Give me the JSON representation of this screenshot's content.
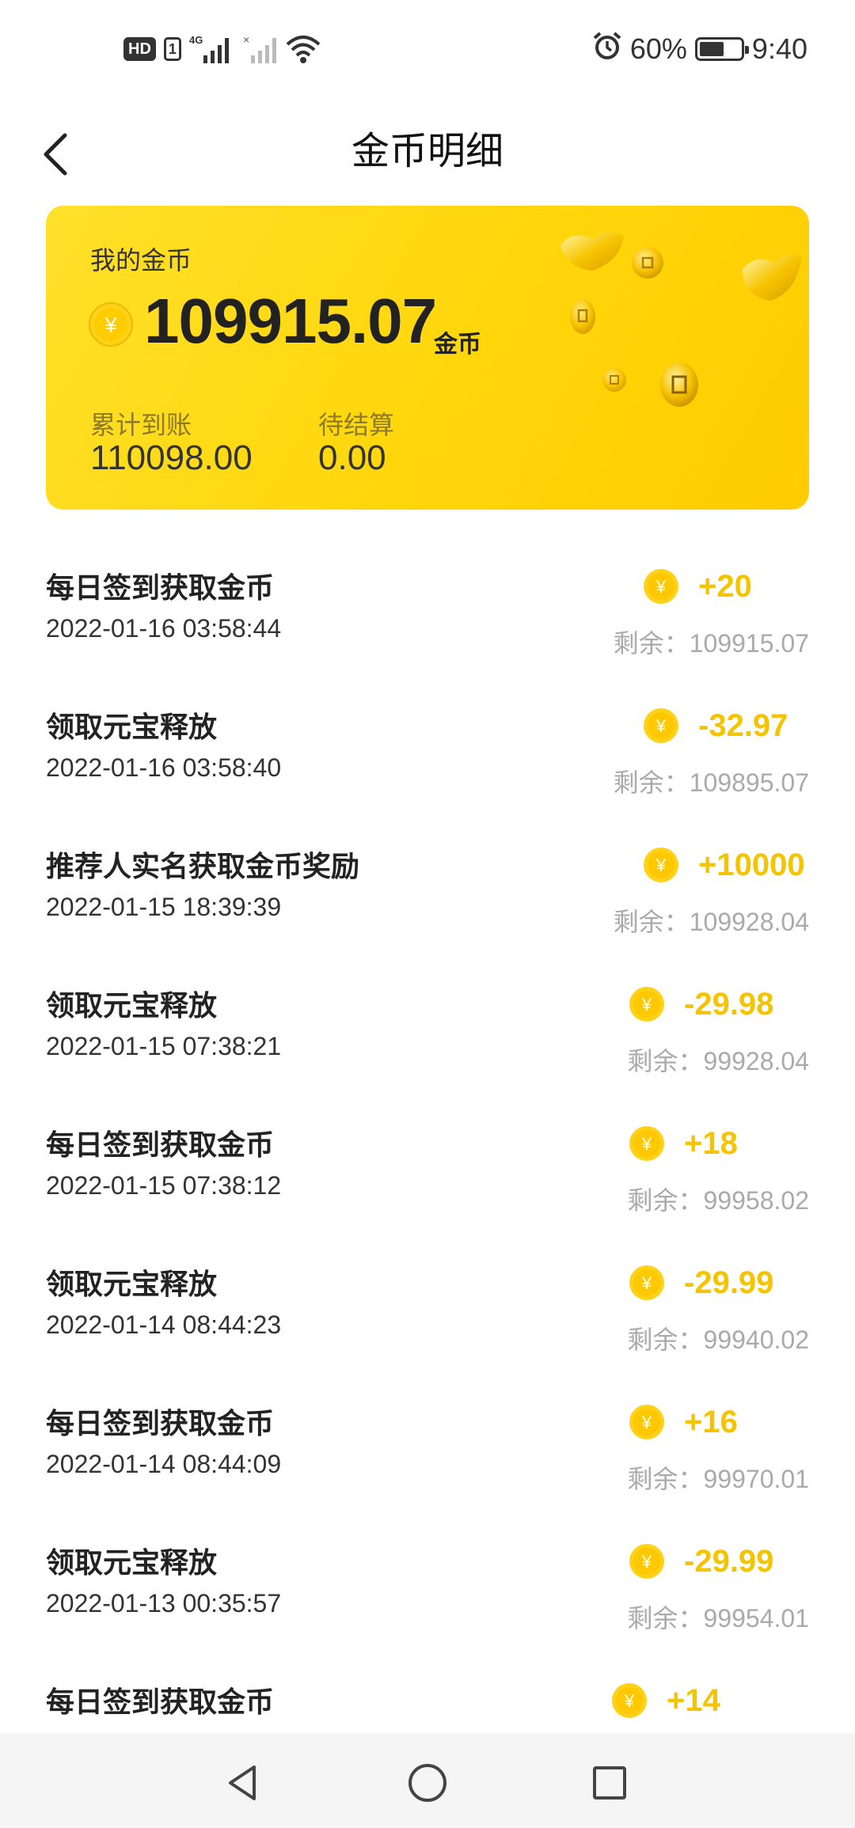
{
  "status_bar": {
    "hd": "HD",
    "sim": "1",
    "net": "4G",
    "battery_percent": "60%",
    "battery_level": 0.6,
    "time": "9:40"
  },
  "header": {
    "title": "金币明细"
  },
  "card": {
    "label": "我的金币",
    "coin_symbol": "¥",
    "amount": "109915.07",
    "unit": "金币",
    "stats": [
      {
        "label": "累计到账",
        "value": "110098.00"
      },
      {
        "label": "待结算",
        "value": "0.00"
      }
    ]
  },
  "records": [
    {
      "title": "每日签到获取金币",
      "time": "2022-01-16 03:58:44",
      "amount": "+20",
      "balance": "剩余：109915.07"
    },
    {
      "title": "领取元宝释放",
      "time": "2022-01-16 03:58:40",
      "amount": "-32.97",
      "balance": "剩余：109895.07"
    },
    {
      "title": "推荐人实名获取金币奖励",
      "time": "2022-01-15 18:39:39",
      "amount": "+10000",
      "balance": "剩余：109928.04"
    },
    {
      "title": "领取元宝释放",
      "time": "2022-01-15 07:38:21",
      "amount": "-29.98",
      "balance": "剩余：99928.04"
    },
    {
      "title": "每日签到获取金币",
      "time": "2022-01-15 07:38:12",
      "amount": "+18",
      "balance": "剩余：99958.02"
    },
    {
      "title": "领取元宝释放",
      "time": "2022-01-14 08:44:23",
      "amount": "-29.99",
      "balance": "剩余：99940.02"
    },
    {
      "title": "每日签到获取金币",
      "time": "2022-01-14 08:44:09",
      "amount": "+16",
      "balance": "剩余：99970.01"
    },
    {
      "title": "领取元宝释放",
      "time": "2022-01-13 00:35:57",
      "amount": "-29.99",
      "balance": "剩余：99954.01"
    },
    {
      "title": "每日签到获取金币",
      "time": "",
      "amount": "+14",
      "balance": ""
    }
  ],
  "colors": {
    "accent": "#f5c400",
    "card_yellow": "#ffd60a",
    "muted": "#aaaaaa"
  },
  "icons": {
    "back": "chevron-left-icon",
    "coin": "yuan-coin-icon",
    "nav_back": "triangle-back-icon",
    "nav_home": "circle-home-icon",
    "nav_recent": "square-recent-icon"
  }
}
